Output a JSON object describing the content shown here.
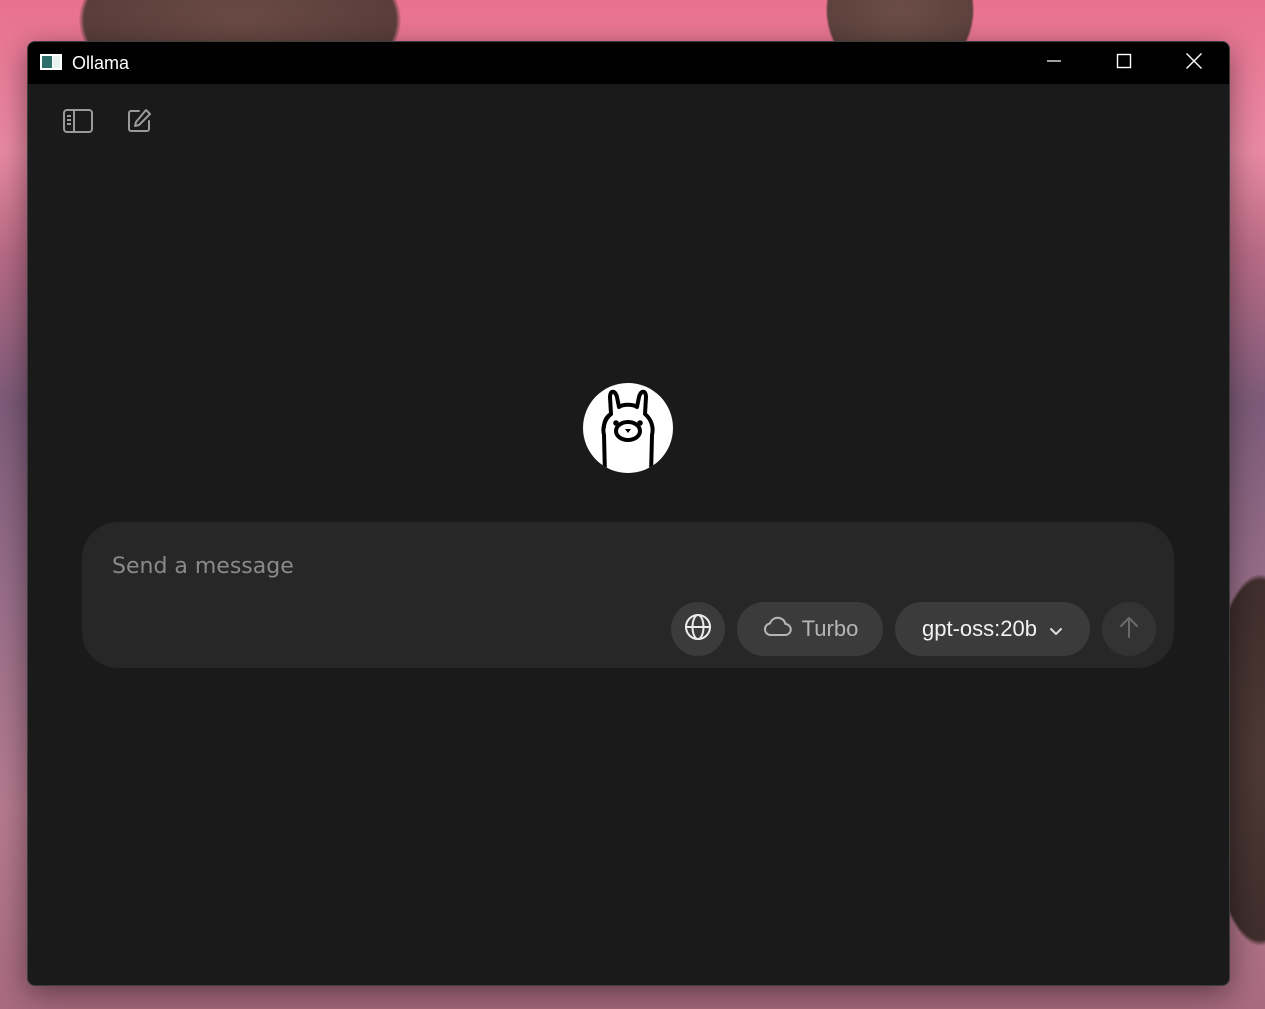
{
  "window": {
    "title": "Ollama",
    "controls": {
      "minimize": "minimize-icon",
      "maximize": "maximize-icon",
      "close": "close-icon"
    }
  },
  "toolbar": {
    "sidebar_toggle_icon": "sidebar-icon",
    "new_chat_icon": "new-chat-icon"
  },
  "logo": {
    "icon": "ollama-llama-logo"
  },
  "composer": {
    "placeholder": "Send a message",
    "web_search_icon": "globe-icon",
    "turbo_label": "Turbo",
    "turbo_icon": "cloud-icon",
    "model_label": "gpt-oss:20b",
    "model_dropdown_icon": "chevron-down-icon",
    "send_icon": "arrow-up-icon"
  },
  "colors": {
    "window_bg": "#1a1a1a",
    "titlebar_bg": "#000000",
    "composer_bg": "#272727",
    "pill_bg": "#3b3b3b",
    "send_bg": "#333333"
  }
}
